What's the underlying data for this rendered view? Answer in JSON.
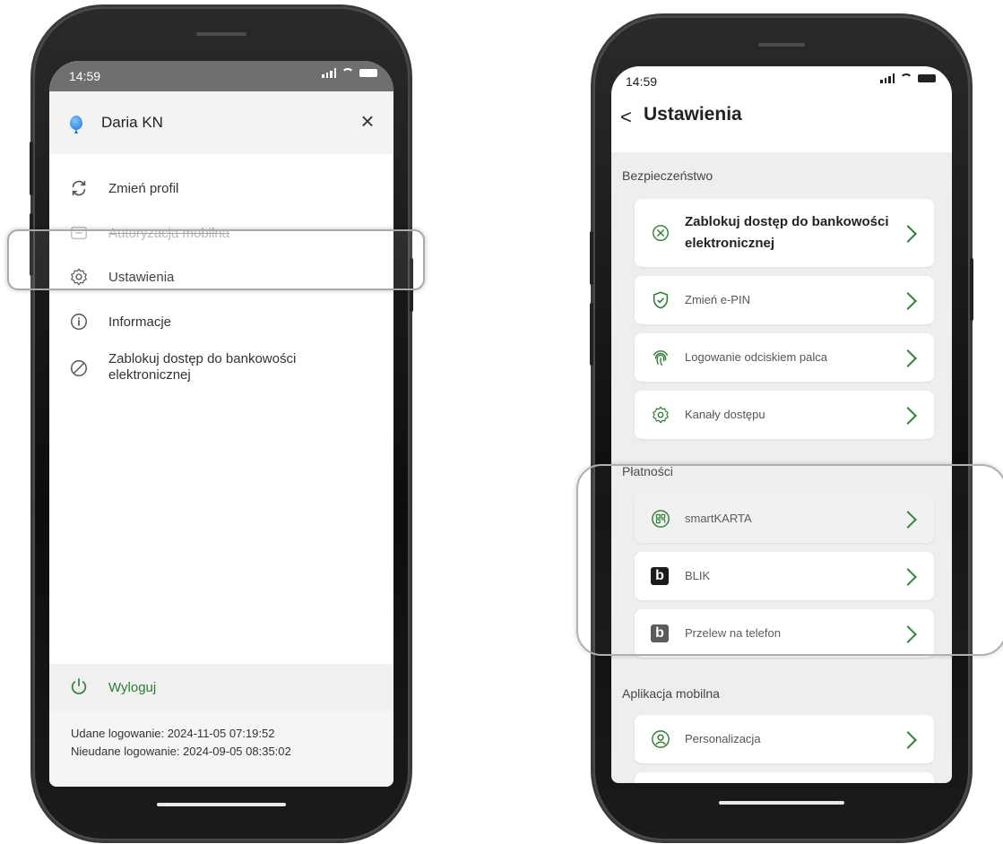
{
  "left_phone": {
    "status": {
      "time": "14:59"
    },
    "profile": {
      "name": "Daria KN",
      "close_icon": "×"
    },
    "menu": [
      {
        "label": "Zmień profil",
        "icon": "refresh-icon"
      },
      {
        "label": "Autoryzacja mobilna",
        "icon": "mobile-auth-icon"
      },
      {
        "label": "Ustawienia",
        "icon": "gear-icon"
      },
      {
        "label": "Informacje",
        "icon": "info-icon"
      },
      {
        "label": "Zablokuj dostęp do bankowości",
        "label2": "elektronicznej",
        "icon": "block-icon"
      }
    ],
    "logout": {
      "label": "Wyloguj"
    },
    "login_info": {
      "success": "Udane logowanie: 2024-11-05 07:19:52",
      "failed": "Nieudane logowanie: 2024-09-05 08:35:02"
    }
  },
  "right_phone": {
    "status": {
      "time": "14:59"
    },
    "header": {
      "back": "<",
      "title": "Ustawienia"
    },
    "sections": {
      "security": "Bezpieczeństwo",
      "payments": "Płatności",
      "mobile_app": "Aplikacja mobilna"
    },
    "security_items": [
      {
        "label": "Zablokuj dostęp do bankowości",
        "label2": "elektronicznej",
        "icon": "block-circle-icon"
      },
      {
        "label": "Zmień e-PIN",
        "icon": "shield-check-icon"
      },
      {
        "label": "Logowanie odciskiem palca",
        "icon": "fingerprint-icon"
      },
      {
        "label": "Kanały dostępu",
        "icon": "gear-icon"
      }
    ],
    "payment_items": [
      {
        "label": "smartKARTA",
        "icon": "qr-card-icon"
      },
      {
        "label": "BLIK",
        "icon": "blik-logo-icon"
      },
      {
        "label": "Przelew na telefon",
        "icon": "blik-phone-icon"
      }
    ],
    "app_items": [
      {
        "label": "Personalizacja",
        "icon": "person-circle-icon"
      }
    ]
  },
  "colors": {
    "accent": "#2e7d32"
  }
}
